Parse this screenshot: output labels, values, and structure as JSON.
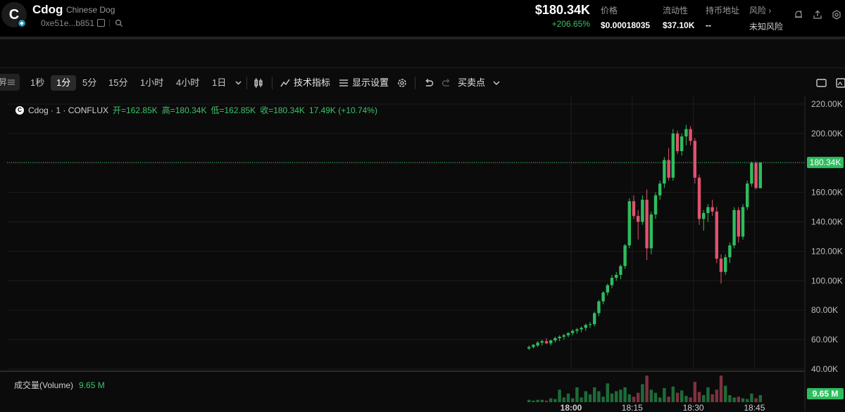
{
  "header": {
    "avatar_letter": "C",
    "token_symbol": "Cdog",
    "token_name": "Chinese Dog",
    "address": "0xe51e...b851",
    "price_usd": "$180.34K",
    "price_change": "+206.65%",
    "stats": [
      {
        "label": "价格",
        "value": "$0.00018035"
      },
      {
        "label": "流动性",
        "value": "$37.10K"
      },
      {
        "label": "持币地址",
        "value": "--"
      },
      {
        "label": "风险 ›",
        "value": "未知风险"
      }
    ]
  },
  "toolbar": {
    "left_partial": "昇",
    "intervals": [
      "1秒",
      "1分",
      "5分",
      "15分",
      "1小时",
      "4小时",
      "1日"
    ],
    "active_interval": "1分",
    "indicators": "技术指标",
    "display_settings": "显示设置",
    "buy_sell_points": "买卖点"
  },
  "legend": {
    "symbol": "Cdog · 1 · CONFLUX",
    "open": "开=162.85K",
    "high": "高=180.34K",
    "low": "低=162.85K",
    "close": "收=180.34K",
    "change": "17.49K (+10.74%)"
  },
  "volume_legend": {
    "label": "成交量(Volume)",
    "value": "9.65 M",
    "axis_label": "9.65 M"
  },
  "colors": {
    "up": "#2ebd5f",
    "down": "#e0526e",
    "background": "#0b0b0b",
    "price_line": "#3cc26a"
  },
  "chart_data": {
    "type": "candlestick",
    "ylim": [
      40000,
      220000
    ],
    "y_ticks": [
      "220.00K",
      "200.00K",
      "180.00K",
      "160.00K",
      "140.00K",
      "120.00K",
      "100.00K",
      "80.00K",
      "60.00K",
      "40.00K"
    ],
    "x_ticks": [
      "18:00",
      "18:15",
      "18:30",
      "18:45"
    ],
    "last_price_label": "180.34K",
    "last_price": 180340,
    "candles": [
      {
        "o": 54000,
        "h": 56000,
        "l": 53000,
        "c": 55000,
        "v": 0.3
      },
      {
        "o": 55000,
        "h": 57000,
        "l": 54000,
        "c": 56500,
        "v": 0.2
      },
      {
        "o": 56000,
        "h": 59000,
        "l": 55000,
        "c": 58000,
        "v": 0.3
      },
      {
        "o": 58000,
        "h": 60000,
        "l": 56000,
        "c": 59000,
        "v": 0.3
      },
      {
        "o": 59000,
        "h": 61000,
        "l": 57000,
        "c": 57500,
        "v": 0.2
      },
      {
        "o": 57500,
        "h": 60000,
        "l": 56000,
        "c": 59500,
        "v": 0.5
      },
      {
        "o": 59500,
        "h": 62000,
        "l": 58000,
        "c": 61000,
        "v": 0.4
      },
      {
        "o": 61000,
        "h": 63000,
        "l": 59000,
        "c": 62000,
        "v": 1.6
      },
      {
        "o": 62000,
        "h": 64000,
        "l": 60000,
        "c": 63000,
        "v": 0.6
      },
      {
        "o": 63000,
        "h": 65000,
        "l": 61500,
        "c": 64500,
        "v": 1.1
      },
      {
        "o": 64500,
        "h": 67000,
        "l": 63000,
        "c": 66000,
        "v": 0.5
      },
      {
        "o": 66000,
        "h": 68000,
        "l": 64000,
        "c": 67000,
        "v": 1.9
      },
      {
        "o": 67000,
        "h": 69000,
        "l": 65000,
        "c": 68000,
        "v": 0.6
      },
      {
        "o": 68000,
        "h": 71000,
        "l": 66000,
        "c": 70000,
        "v": 1.4
      },
      {
        "o": 70000,
        "h": 72000,
        "l": 68000,
        "c": 70500,
        "v": 1.0
      },
      {
        "o": 70500,
        "h": 79000,
        "l": 69000,
        "c": 78000,
        "v": 1.9
      },
      {
        "o": 78000,
        "h": 87000,
        "l": 76000,
        "c": 86000,
        "v": 1.4
      },
      {
        "o": 86000,
        "h": 93000,
        "l": 84000,
        "c": 92000,
        "v": 0.7
      },
      {
        "o": 92000,
        "h": 98000,
        "l": 90000,
        "c": 97000,
        "v": 2.4
      },
      {
        "o": 97000,
        "h": 104000,
        "l": 95000,
        "c": 102000,
        "v": 1.1
      },
      {
        "o": 102000,
        "h": 106000,
        "l": 100000,
        "c": 104000,
        "v": 1.4
      },
      {
        "o": 104000,
        "h": 111000,
        "l": 101000,
        "c": 110000,
        "v": 1.6
      },
      {
        "o": 110000,
        "h": 125000,
        "l": 108000,
        "c": 124000,
        "v": 1.9
      },
      {
        "o": 124000,
        "h": 156000,
        "l": 122000,
        "c": 154000,
        "v": 1.0
      },
      {
        "o": 154000,
        "h": 158000,
        "l": 142000,
        "c": 144000,
        "v": 0.7
      },
      {
        "o": 144000,
        "h": 148000,
        "l": 128000,
        "c": 140000,
        "v": 1.2
      },
      {
        "o": 140000,
        "h": 158000,
        "l": 138000,
        "c": 155000,
        "v": 2.3
      },
      {
        "o": 155000,
        "h": 162000,
        "l": 114000,
        "c": 122000,
        "v": 3.4
      },
      {
        "o": 122000,
        "h": 147000,
        "l": 118000,
        "c": 145000,
        "v": 1.6
      },
      {
        "o": 145000,
        "h": 160000,
        "l": 142000,
        "c": 158000,
        "v": 1.2
      },
      {
        "o": 158000,
        "h": 168000,
        "l": 155000,
        "c": 166000,
        "v": 0.6
      },
      {
        "o": 166000,
        "h": 184000,
        "l": 163000,
        "c": 182000,
        "v": 1.8
      },
      {
        "o": 182000,
        "h": 190000,
        "l": 168000,
        "c": 170000,
        "v": 0.7
      },
      {
        "o": 170000,
        "h": 203000,
        "l": 168000,
        "c": 200000,
        "v": 2.0
      },
      {
        "o": 200000,
        "h": 202000,
        "l": 186000,
        "c": 188000,
        "v": 1.2
      },
      {
        "o": 188000,
        "h": 200000,
        "l": 185000,
        "c": 198000,
        "v": 1.5
      },
      {
        "o": 198000,
        "h": 206000,
        "l": 192000,
        "c": 203000,
        "v": 0.8
      },
      {
        "o": 203000,
        "h": 205000,
        "l": 192000,
        "c": 195000,
        "v": 0.6
      },
      {
        "o": 195000,
        "h": 197000,
        "l": 166000,
        "c": 170000,
        "v": 2.6
      },
      {
        "o": 170000,
        "h": 172000,
        "l": 138000,
        "c": 142000,
        "v": 1.3
      },
      {
        "o": 142000,
        "h": 148000,
        "l": 134000,
        "c": 146000,
        "v": 0.9
      },
      {
        "o": 146000,
        "h": 152000,
        "l": 140000,
        "c": 150000,
        "v": 1.9
      },
      {
        "o": 150000,
        "h": 155000,
        "l": 144000,
        "c": 147000,
        "v": 1.0
      },
      {
        "o": 147000,
        "h": 150000,
        "l": 112000,
        "c": 115000,
        "v": 1.6
      },
      {
        "o": 115000,
        "h": 118000,
        "l": 98000,
        "c": 106000,
        "v": 3.4
      },
      {
        "o": 106000,
        "h": 118000,
        "l": 104000,
        "c": 116000,
        "v": 2.1
      },
      {
        "o": 116000,
        "h": 126000,
        "l": 112000,
        "c": 124000,
        "v": 0.9
      },
      {
        "o": 124000,
        "h": 150000,
        "l": 122000,
        "c": 148000,
        "v": 0.6
      },
      {
        "o": 148000,
        "h": 150000,
        "l": 126000,
        "c": 130000,
        "v": 0.7
      },
      {
        "o": 130000,
        "h": 152000,
        "l": 128000,
        "c": 150000,
        "v": 0.5
      },
      {
        "o": 150000,
        "h": 168000,
        "l": 148000,
        "c": 166000,
        "v": 0.4
      },
      {
        "o": 166000,
        "h": 181000,
        "l": 164000,
        "c": 180000,
        "v": 1.1
      },
      {
        "o": 180000,
        "h": 181000,
        "l": 162000,
        "c": 163000,
        "v": 0.5
      },
      {
        "o": 162850,
        "h": 180340,
        "l": 162850,
        "c": 180340,
        "v": 0.9
      }
    ]
  }
}
